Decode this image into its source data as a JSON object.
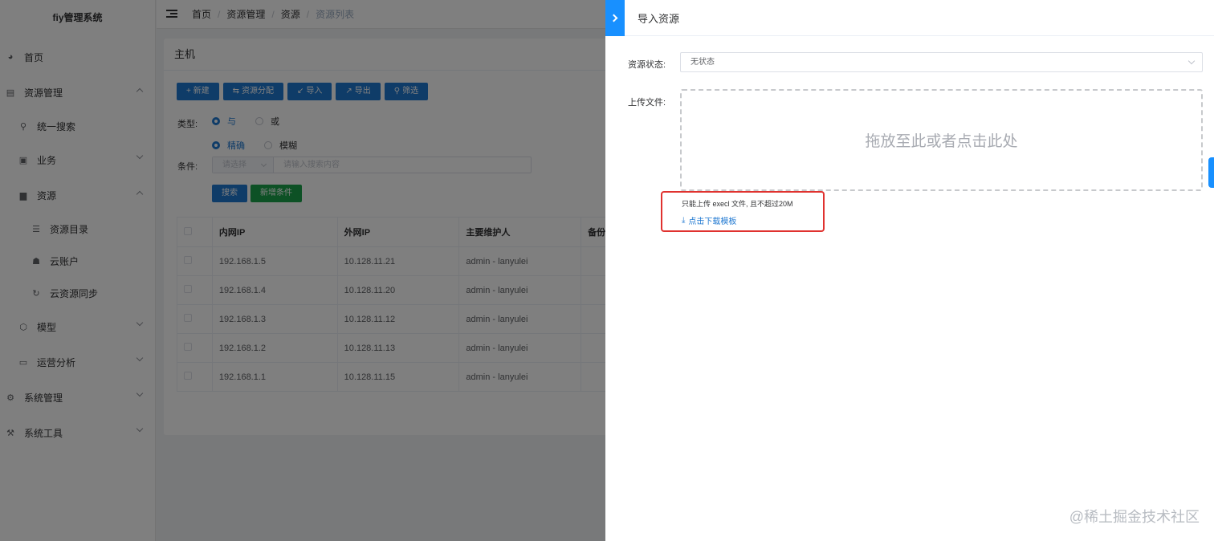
{
  "app": {
    "title": "fiy管理系统"
  },
  "sidebar": {
    "items": [
      {
        "label": "首页",
        "icon": "dashboard-icon"
      },
      {
        "label": "资源管理",
        "icon": "resource-icon"
      },
      {
        "label": "统一搜索",
        "icon": "search-icon"
      },
      {
        "label": "业务",
        "icon": "business-icon"
      },
      {
        "label": "资源",
        "icon": "resource-icon"
      },
      {
        "label": "资源目录",
        "icon": "list-icon"
      },
      {
        "label": "云账户",
        "icon": "cloud-account-icon"
      },
      {
        "label": "云资源同步",
        "icon": "sync-icon"
      },
      {
        "label": "模型",
        "icon": "model-icon"
      },
      {
        "label": "运营分析",
        "icon": "monitor-icon"
      },
      {
        "label": "系统管理",
        "icon": "settings-icon"
      },
      {
        "label": "系统工具",
        "icon": "tools-icon"
      }
    ]
  },
  "breadcrumb": [
    "首页",
    "资源管理",
    "资源",
    "资源列表"
  ],
  "card": {
    "title": "主机",
    "buttons": {
      "new": "+ 新建",
      "assign": "资源分配",
      "import": "导入",
      "export": "导出",
      "filter": "筛选"
    },
    "type_label": "类型:",
    "radios": {
      "and": "与",
      "or": "或",
      "exact": "精确",
      "fuzzy": "模糊"
    },
    "condition_label": "条件:",
    "select_placeholder": "请选择",
    "input_placeholder": "请输入搜索内容",
    "search_button": "搜索",
    "add_condition_button": "新增条件"
  },
  "table": {
    "headers": [
      "内网IP",
      "外网IP",
      "主要维护人",
      "备份"
    ],
    "rows": [
      [
        "192.168.1.5",
        "10.128.11.21",
        "admin - lanyulei"
      ],
      [
        "192.168.1.4",
        "10.128.11.20",
        "admin - lanyulei"
      ],
      [
        "192.168.1.3",
        "10.128.11.12",
        "admin - lanyulei"
      ],
      [
        "192.168.1.2",
        "10.128.11.13",
        "admin - lanyulei"
      ],
      [
        "192.168.1.1",
        "10.128.11.15",
        "admin - lanyulei"
      ]
    ]
  },
  "drawer": {
    "title": "导入资源",
    "status_label": "资源状态:",
    "status_value": "无状态",
    "upload_label": "上传文件:",
    "dropzone_text": "拖放至此或者点击此处",
    "tip": "只能上传 execl 文件, 且不超过20M",
    "download_link": "点击下载模板"
  },
  "watermark": "@稀土掘金技术社区",
  "colors": {
    "primary": "#1f78d1",
    "success": "#1aa34a",
    "highlight": "#e0322f",
    "drawer_tab": "#1890ff"
  }
}
